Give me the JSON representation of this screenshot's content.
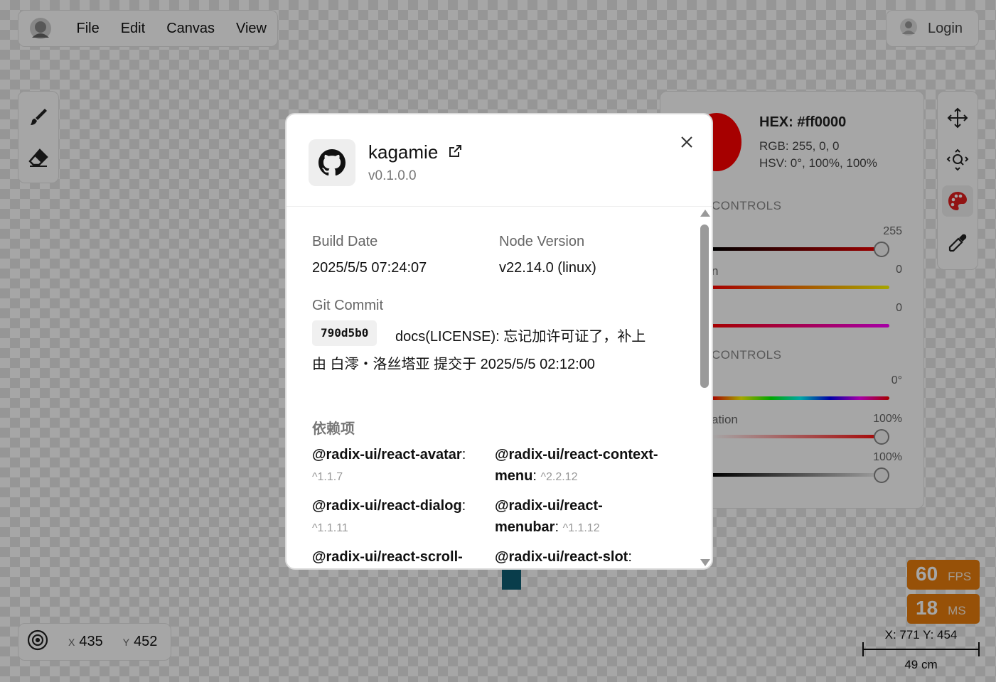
{
  "menubar": {
    "logo_icon": "avatar-logo-icon",
    "items": [
      "File",
      "Edit",
      "Canvas",
      "View"
    ]
  },
  "login": {
    "label": "Login",
    "icon": "user-avatar-icon"
  },
  "left_tools": [
    "brush-icon",
    "eraser-icon"
  ],
  "right_tools": [
    "move-icon",
    "zoom-icon",
    "palette-icon",
    "eyedropper-icon"
  ],
  "color_panel": {
    "swatch_color": "#ff0000",
    "hex": "HEX: #ff0000",
    "rgb": "RGB: 255, 0, 0",
    "hsv": "HSV: 0°, 100%, 100%",
    "rgb_section": "CONTROLS",
    "hsv_section": "CONTROLS",
    "sliders": [
      {
        "label": "",
        "value": "255"
      },
      {
        "label": "n",
        "value": "0"
      },
      {
        "label": "",
        "value": "0"
      },
      {
        "label": "",
        "value": "0°"
      },
      {
        "label": "ation",
        "value": "100%"
      },
      {
        "label": "",
        "value": "100%"
      }
    ]
  },
  "stats": {
    "fps": "60",
    "fps_unit": "FPS",
    "ms": "18",
    "ms_unit": "MS"
  },
  "ruler": {
    "coords": "X: 771  Y: 454",
    "scale": "49 cm"
  },
  "cursor": {
    "x_label": "X",
    "x": "435",
    "y_label": "Y",
    "y": "452"
  },
  "dialog": {
    "title": "kagamie",
    "version": "v0.1.0.0",
    "build_date_label": "Build Date",
    "build_date": "2025/5/5 07:24:07",
    "node_version_label": "Node Version",
    "node_version": "v22.14.0 (linux)",
    "git_commit_label": "Git Commit",
    "commit_hash": "790d5b0",
    "commit_message": "docs(LICENSE): 忘记加许可证了，补上",
    "commit_by": "由 白澪・洛丝塔亚 提交于 2025/5/5 02:12:00",
    "deps_title": "依赖项",
    "deps": [
      {
        "name": "@radix-ui/react-avatar",
        "version": "^1.1.7"
      },
      {
        "name": "@radix-ui/react-context-menu",
        "version": "^2.2.12"
      },
      {
        "name": "@radix-ui/react-dialog",
        "version": "^1.1.11"
      },
      {
        "name": "@radix-ui/react-menubar",
        "version": "^1.1.12"
      },
      {
        "name": "@radix-ui/react-scroll-",
        "version": ""
      },
      {
        "name": "@radix-ui/react-slot",
        "version": ""
      }
    ]
  }
}
